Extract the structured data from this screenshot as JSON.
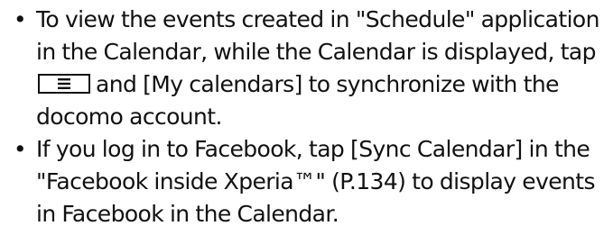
{
  "bullets": [
    {
      "marker": "•",
      "before_key": "To view the events created in \"Schedule\" application in the Calendar, while the Calendar is displayed, tap",
      "key_icon": "menu-key-icon",
      "after_key": "and [My calendars] to synchronize with the docomo account."
    },
    {
      "marker": "•",
      "text": "If you log in to Facebook, tap [Sync Calendar] in the \"Facebook inside Xperia™\" (P.134) to display events in Facebook in the Calendar."
    }
  ]
}
